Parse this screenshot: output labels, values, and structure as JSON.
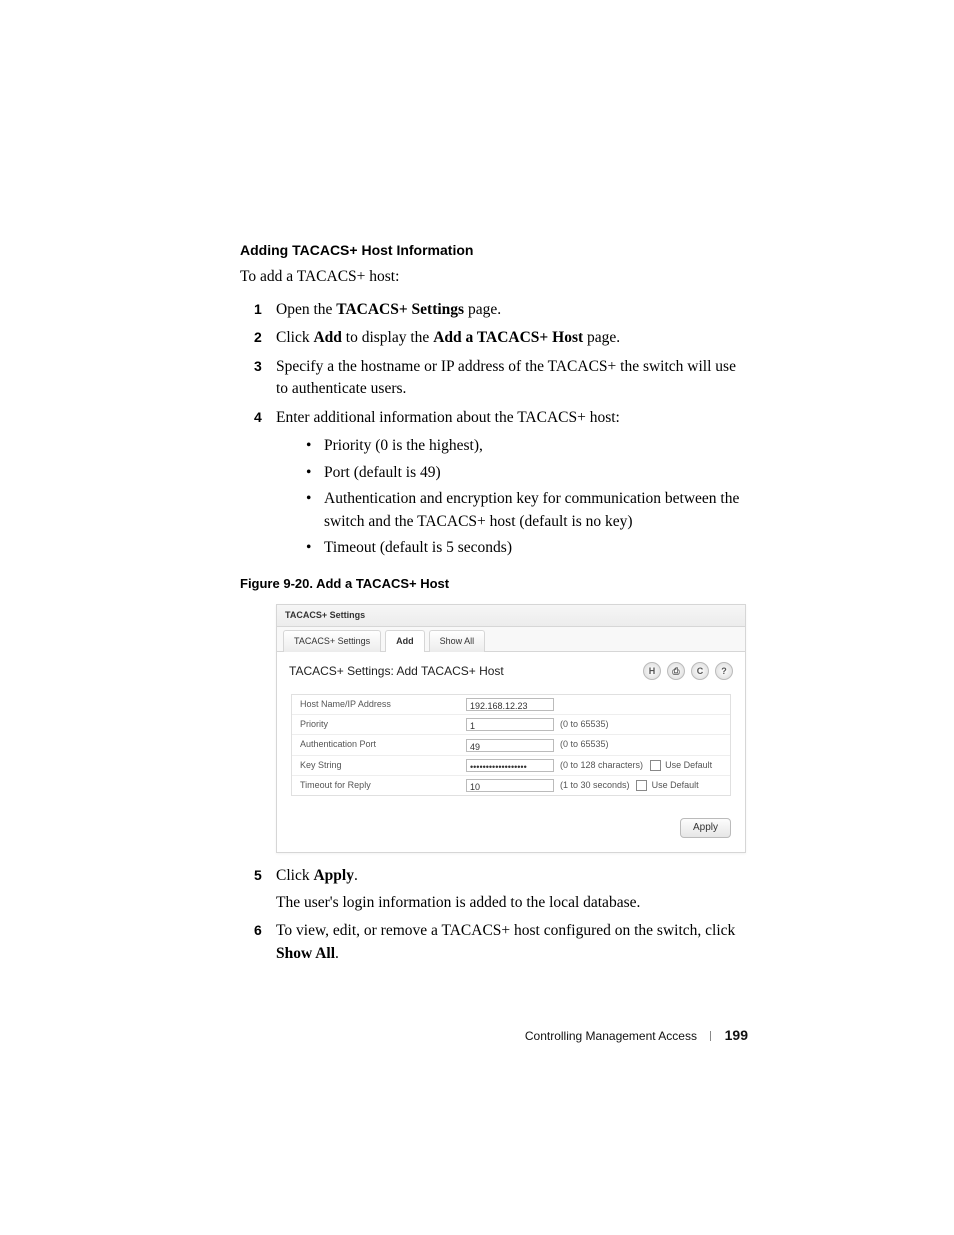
{
  "headings": {
    "section": "Adding TACACS+ Host Information",
    "intro": "To add a TACACS+ host:",
    "figure": "Figure 9-20.    Add a TACACS+ Host"
  },
  "steps": {
    "s1": {
      "num": "1",
      "pre": "Open the ",
      "b1": "TACACS+ Settings",
      "post": " page."
    },
    "s2": {
      "num": "2",
      "pre": "Click ",
      "b1": "Add",
      "mid": " to display the ",
      "b2": "Add a TACACS+ Host",
      "post": " page."
    },
    "s3": {
      "num": "3",
      "text": "Specify a the hostname or IP address of the TACACS+ the switch will use to authenticate users."
    },
    "s4": {
      "num": "4",
      "text": "Enter additional information about the TACACS+ host:"
    },
    "s5": {
      "num": "5",
      "pre": "Click ",
      "b1": "Apply",
      "post": ".",
      "sub": "The user's login information is added to the local database."
    },
    "s6": {
      "num": "6",
      "pre": "To view, edit, or remove a TACACS+ host configured on the switch, click ",
      "b1": "Show All",
      "post": "."
    }
  },
  "bullets": {
    "b1": "Priority (0 is the highest),",
    "b2": "Port (default is 49)",
    "b3": "Authentication and encryption key for communication between the switch and the TACACS+ host (default is no key)",
    "b4": "Timeout (default is 5 seconds)"
  },
  "screenshot": {
    "crumb": "TACACS+ Settings",
    "tabs": {
      "t1": "TACACS+ Settings",
      "t2": "Add",
      "t3": "Show All"
    },
    "title": "TACACS+ Settings: Add TACACS+ Host",
    "icons": {
      "save": "H",
      "print": "⎙",
      "refresh": "C",
      "help": "?"
    },
    "rows": {
      "r1": {
        "label": "Host Name/IP Address",
        "value": "192.168.12.23"
      },
      "r2": {
        "label": "Priority",
        "value": "1",
        "hint": "(0 to 65535)"
      },
      "r3": {
        "label": "Authentication Port",
        "value": "49",
        "hint": "(0 to 65535)"
      },
      "r4": {
        "label": "Key String",
        "value": "••••••••••••••••••",
        "hint": "(0 to 128 characters)",
        "chk": "Use Default"
      },
      "r5": {
        "label": "Timeout for Reply",
        "value": "10",
        "hint": "(1 to 30 seconds)",
        "chk": "Use Default"
      }
    },
    "apply": "Apply"
  },
  "footer": {
    "chapter": "Controlling Management Access",
    "page": "199"
  }
}
